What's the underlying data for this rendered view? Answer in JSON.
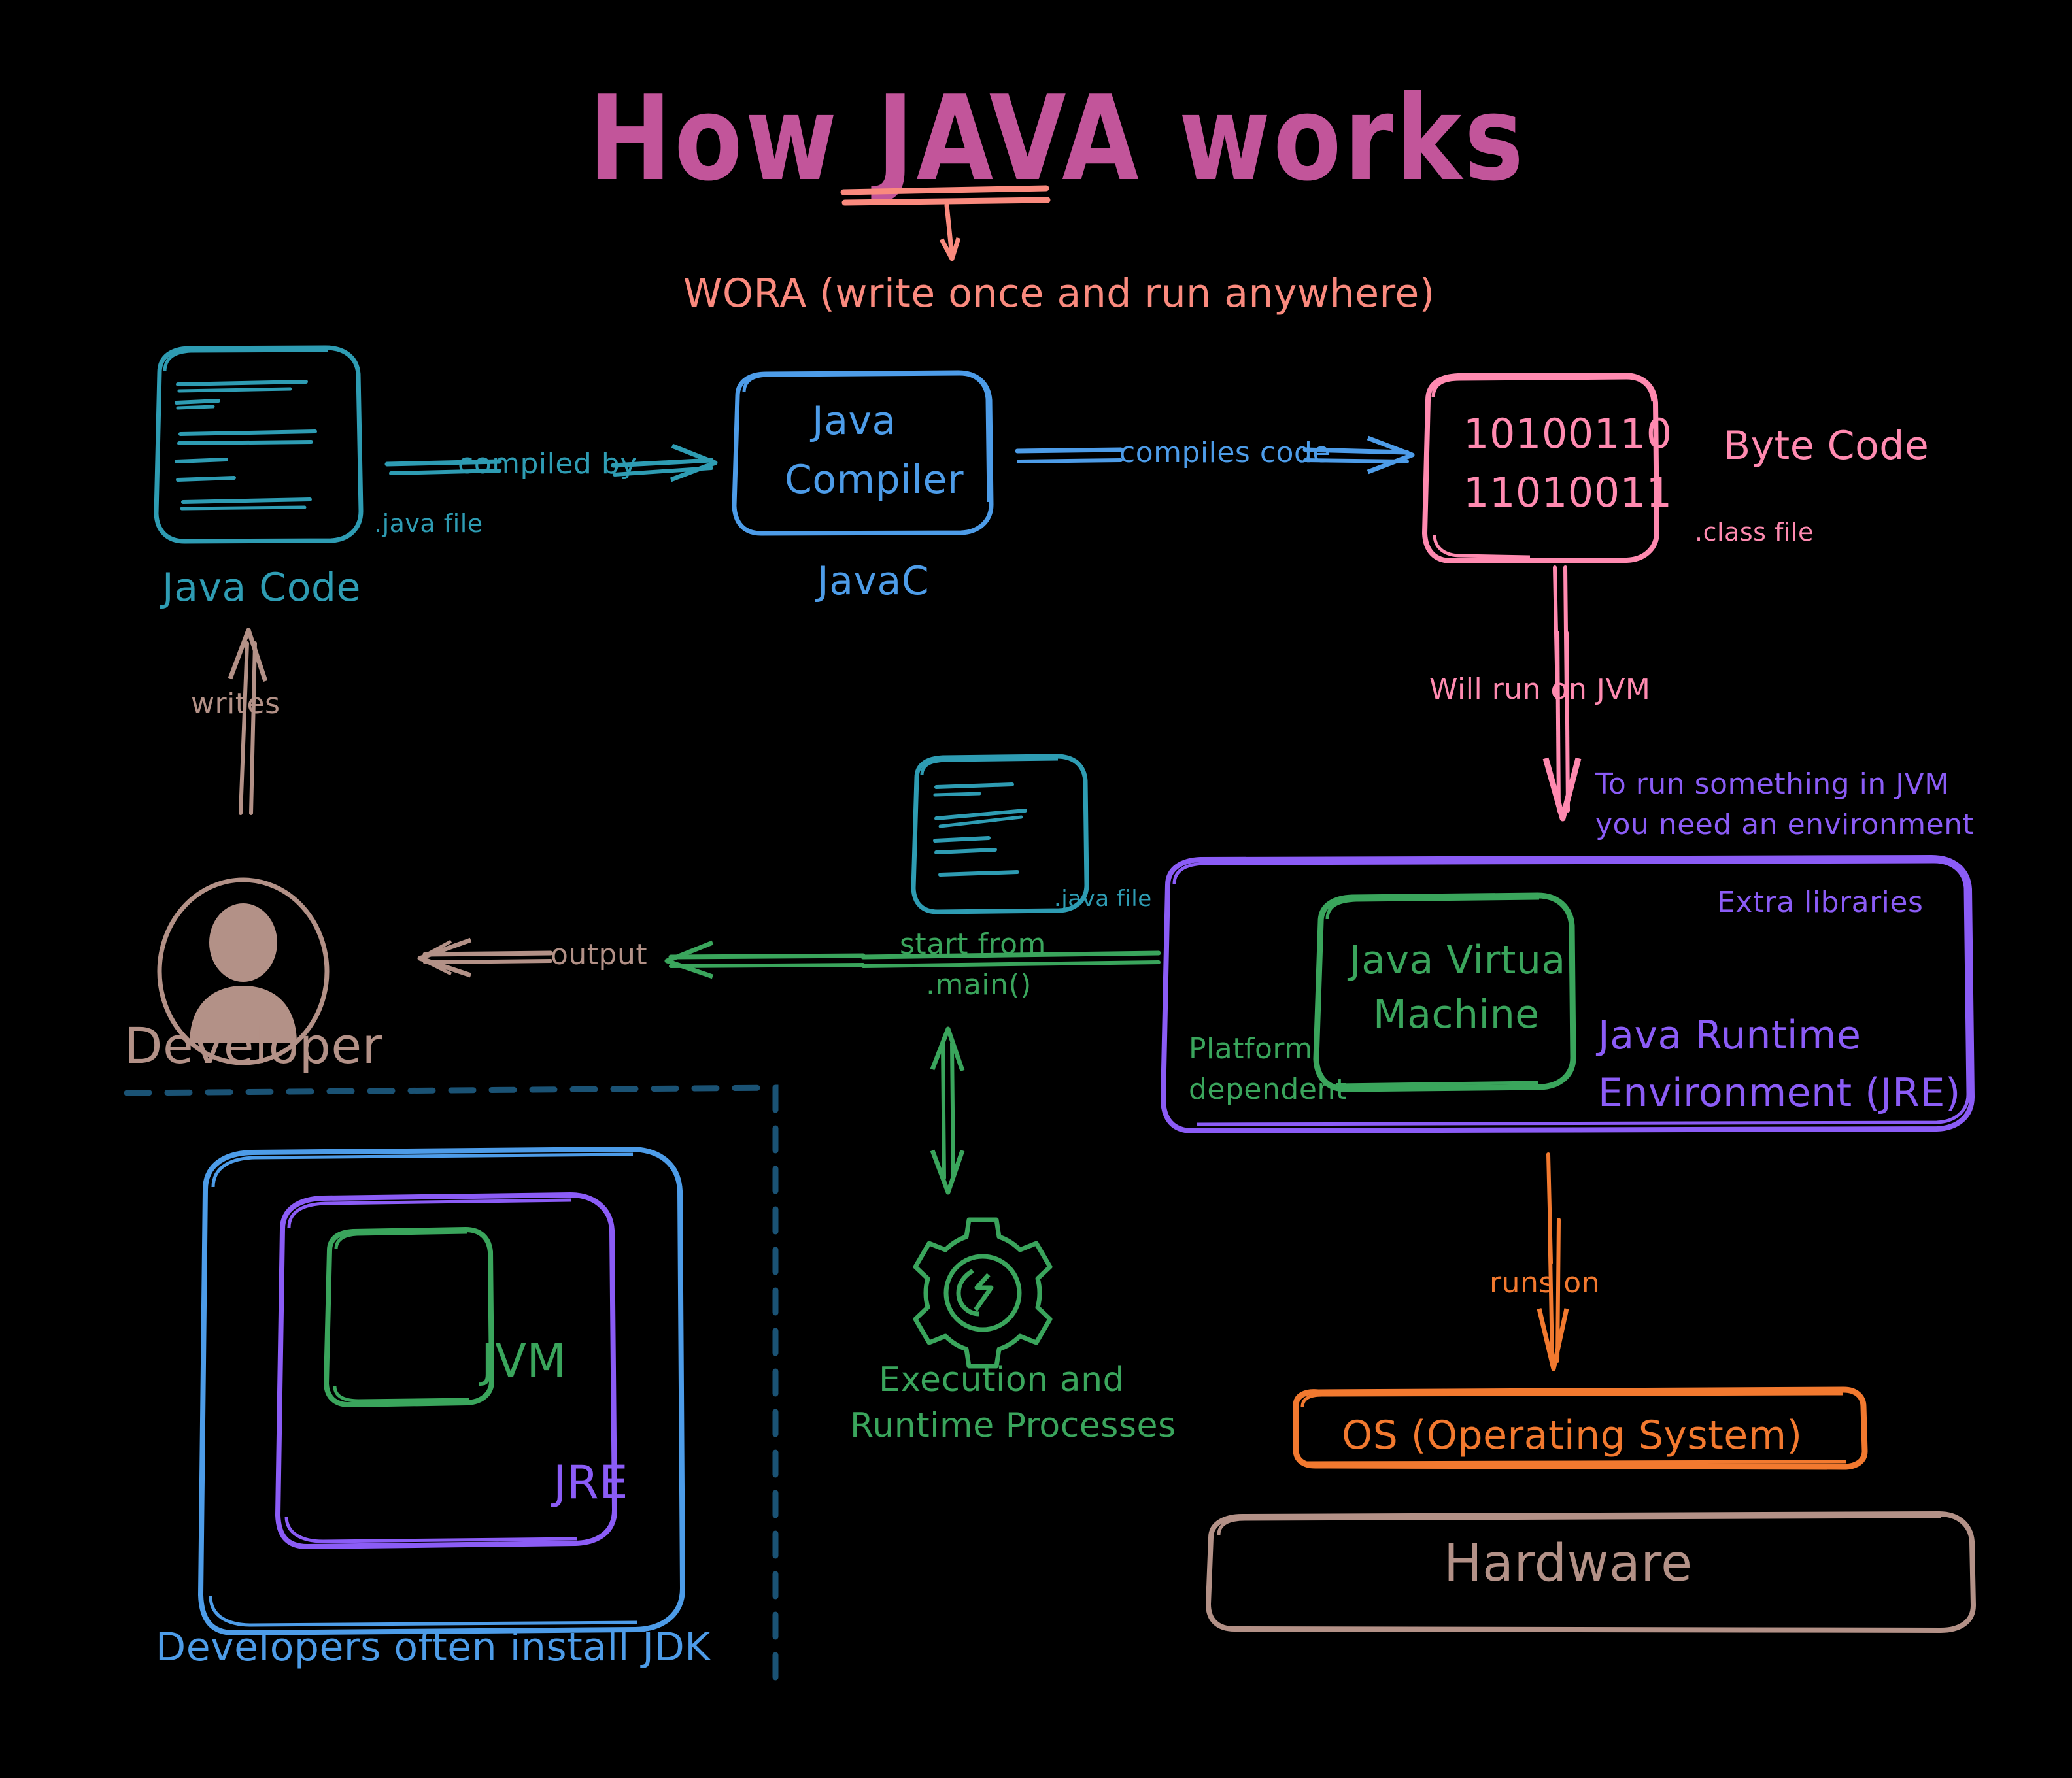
{
  "title": "How JAVA works",
  "subtitle": "WORA (write once and run anywhere)",
  "colors": {
    "title": "#c2559a",
    "subtitle": "#fa8a7e",
    "java_code": "#2e9cb3",
    "compiler": "#4d9ce8",
    "byte_code": "#ff8ab0",
    "jre": "#8b5cf6",
    "jvm": "#3aa55c",
    "developer": "#b39187",
    "os": "#f2792f",
    "hardware": "#b39187",
    "jdk_dashed": "#1a5274"
  },
  "nodes": {
    "java_code": {
      "label": "Java Code",
      "file_label": ".java file"
    },
    "java_compiler": {
      "line1": "Java",
      "line2": "Compiler",
      "label": "JavaC"
    },
    "byte_code": {
      "binary_line1": "10100110",
      "binary_line2": "11010011",
      "label": "Byte Code",
      "file_label": ".class file"
    },
    "jre": {
      "label_line1": "Java Runtime",
      "label_line2": "Environment (JRE)",
      "extra_libraries": "Extra libraries"
    },
    "jvm": {
      "line1": "Java Virtual",
      "line2": "Machine",
      "platform_line1": "Platform",
      "platform_line2": "dependent"
    },
    "second_code_file": {
      "file_label": ".java file"
    },
    "developer": {
      "label": "Developer"
    },
    "execution": {
      "line1": "Execution and",
      "line2": "Runtime Processes"
    },
    "os": {
      "label": "OS (Operating System)"
    },
    "hardware": {
      "label": "Hardware"
    },
    "jdk_group": {
      "jvm_label": "JVM",
      "jre_label": "JRE",
      "caption": "Developers often install JDK"
    }
  },
  "edges": {
    "compiled_by": "compiled by",
    "compiles_code": "compiles code",
    "will_run_on_jvm": "Will run on JVM",
    "environment_note_line1": "To run something in JVM",
    "environment_note_line2": "you need an environment",
    "start_from_line1": "start from",
    "start_from_line2": ".main()",
    "output": "output",
    "writes": "writes",
    "runs_on": "runs on"
  }
}
